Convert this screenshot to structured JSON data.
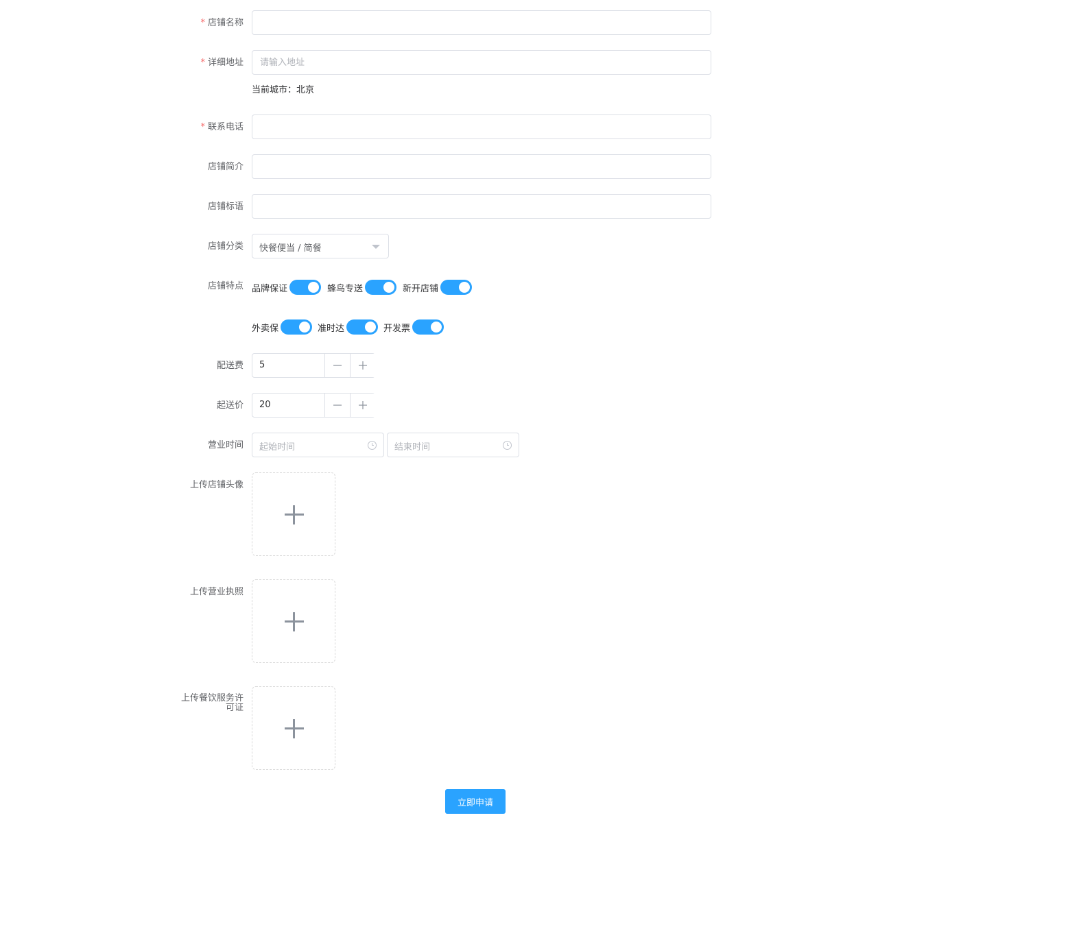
{
  "form": {
    "shop_name": {
      "label": "店铺名称",
      "required_mark": "*",
      "value": ""
    },
    "address": {
      "label": "详细地址",
      "required_mark": "*",
      "placeholder": "请输入地址",
      "current_city": "当前城市：北京"
    },
    "phone": {
      "label": "联系电话",
      "required_mark": "*",
      "value": ""
    },
    "intro": {
      "label": "店铺简介",
      "value": ""
    },
    "slogan": {
      "label": "店铺标语",
      "value": ""
    },
    "category": {
      "label": "店铺分类",
      "selected": "快餐便当 / 简餐"
    },
    "features": {
      "label": "店铺特点",
      "items": [
        {
          "label": "品牌保证",
          "on": true
        },
        {
          "label": "蜂鸟专送",
          "on": true
        },
        {
          "label": "新开店铺",
          "on": true
        },
        {
          "label": "外卖保",
          "on": true
        },
        {
          "label": "准时达",
          "on": true
        },
        {
          "label": "开发票",
          "on": true
        }
      ]
    },
    "delivery_fee": {
      "label": "配送费",
      "value": "5"
    },
    "min_order": {
      "label": "起送价",
      "value": "20"
    },
    "business_hours": {
      "label": "营业时间",
      "start_placeholder": "起始时间",
      "end_placeholder": "结束时间"
    },
    "upload_avatar": {
      "label": "上传店铺头像"
    },
    "upload_license": {
      "label": "上传营业执照"
    },
    "upload_permit": {
      "label_line1": "上传餐饮服务许",
      "label_line2": "可证"
    },
    "submit_label": "立即申请"
  },
  "colors": {
    "primary": "#2aa3ff",
    "required": "#f56c6c",
    "border": "#dcdfe6"
  }
}
